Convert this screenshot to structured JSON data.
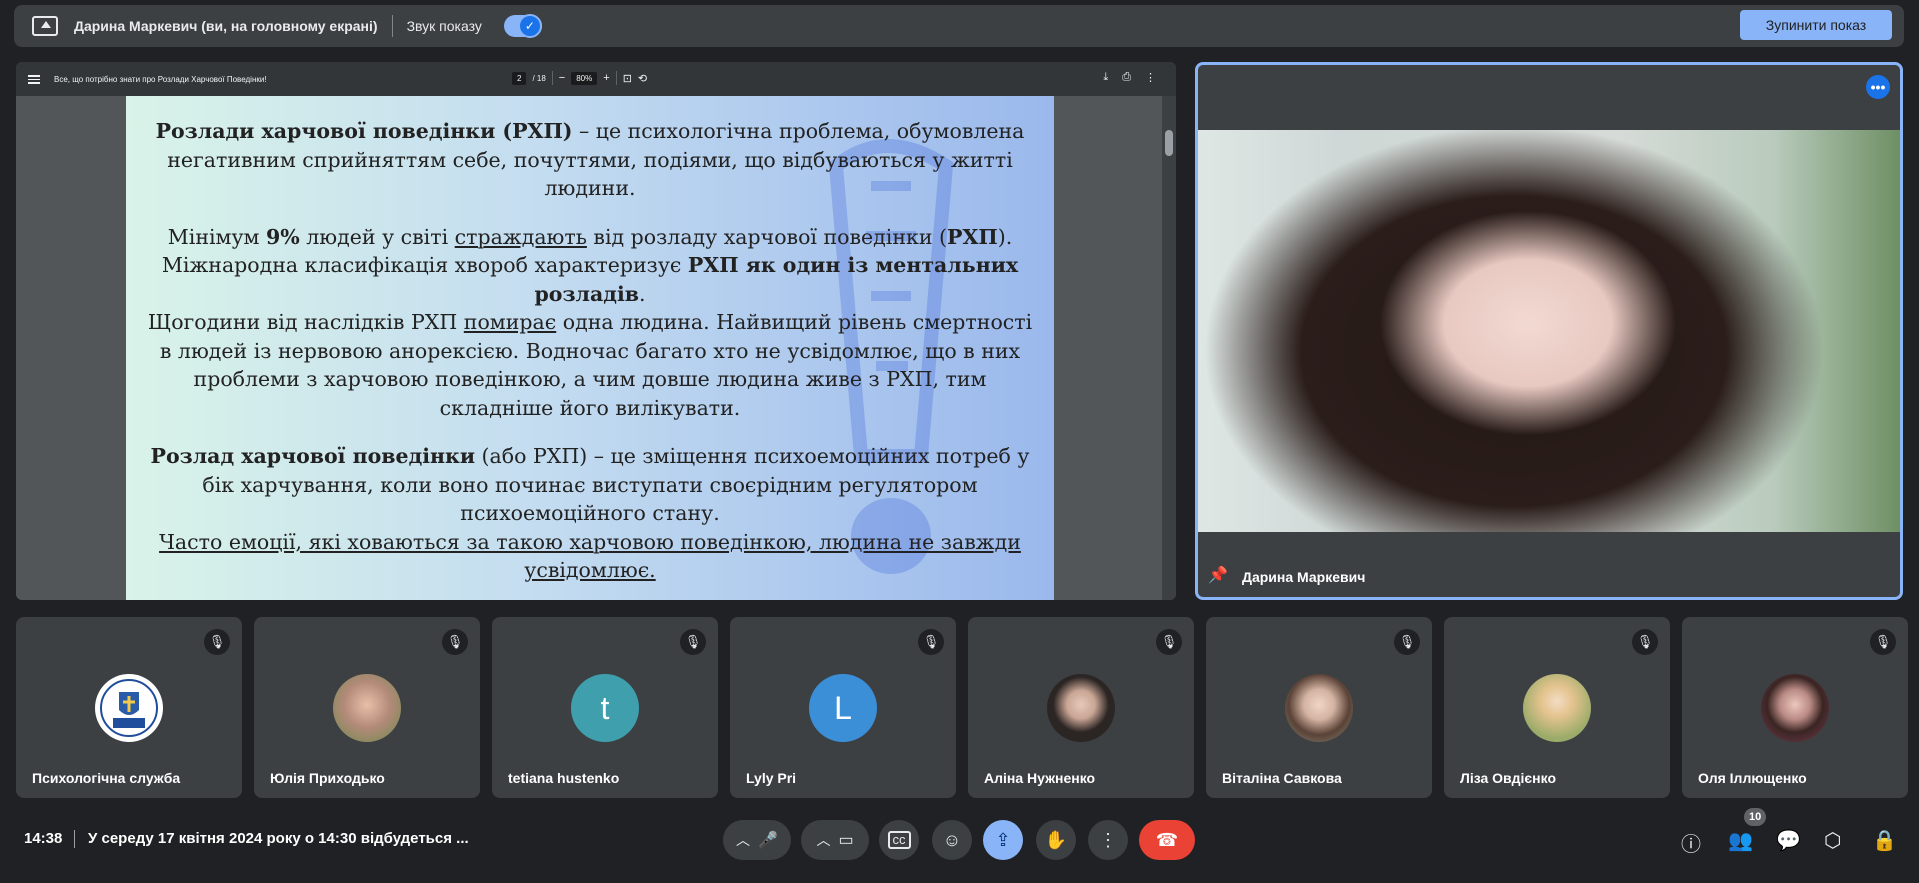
{
  "topbar": {
    "presenter_text": "Дарина Маркевич (ви, на головному екрані)",
    "sound_label": "Звук показу",
    "sound_on": true,
    "stop_button": "Зупинити показ"
  },
  "pdf": {
    "title": "Все, що потрібно знати про Розлади Харчової Поведінки!",
    "page_current": "2",
    "page_total": "/ 18",
    "zoom": "80%"
  },
  "slide": {
    "p1_b": "Розлади харчової поведінки (РХП)",
    "p1_rest": " – це психологічна проблема, обумовлена негативним сприйняттям себе, почуттями, подіями, що відбуваються у житті людини.",
    "p2_a": "Мінімум ",
    "p2_b1": "9%",
    "p2_c": " людей у світі ",
    "p2_u1": "страждають",
    "p2_d": " від розладу харчової поведінки (",
    "p2_b2": "РХП",
    "p2_e": "). Міжнародна класифікація хвороб характеризує ",
    "p2_b3": "РХП як один із ментальних розладів",
    "p2_f": ".",
    "p3_a": "Щогодини від наслідків РХП ",
    "p3_u": "помирає",
    "p3_b": " одна людина. Найвищий рівень смертності в людей із нервовою анорексією. Водночас багато хто не усвідомлює, що в них проблеми з харчовою поведінкою, а чим довше людина живе з РХП, тим складніше його вилікувати.",
    "p4_b": "Розлад харчової поведінки",
    "p4_rest": " (або РХП) – це зміщення психоемоційних потреб у бік харчування, коли воно починає виступати своєрідним регулятором психоемоційного стану.",
    "p5_u": "Часто емоції, які ховаються за такою харчовою поведінкою, людина не завжди усвідомлює."
  },
  "speaker": {
    "name": "Дарина Маркевич"
  },
  "participants": [
    {
      "name": "Психологічна служба",
      "initial": "",
      "avatar_color": "#ffffff",
      "kind": "logo"
    },
    {
      "name": "Юлія Приходько",
      "initial": "",
      "avatar_color": "#b48a7a",
      "kind": "photo"
    },
    {
      "name": "tetiana hustenko",
      "initial": "t",
      "avatar_color": "#3f9fad",
      "kind": "letter"
    },
    {
      "name": "Lyly Pri",
      "initial": "L",
      "avatar_color": "#3b8fd6",
      "kind": "letter"
    },
    {
      "name": "Аліна Нужненко",
      "initial": "",
      "avatar_color": "#2b2524",
      "kind": "photo"
    },
    {
      "name": "Віталіна Савкова",
      "initial": "",
      "avatar_color": "#8c8a7d",
      "kind": "photo"
    },
    {
      "name": "Ліза Овдієнко",
      "initial": "",
      "avatar_color": "#9bab6a",
      "kind": "photo"
    },
    {
      "name": "Оля Іллющенко",
      "initial": "",
      "avatar_color": "#7a3d52",
      "kind": "photo"
    }
  ],
  "bottombar": {
    "time": "14:38",
    "meeting_title": "У середу 17 квітня 2024 року о 14:30 відбудеться ...",
    "participant_count": "10"
  },
  "colors": {
    "accent": "#8ab4f8",
    "end_call": "#ea4335",
    "tile": "#3c4043",
    "background": "#202124"
  }
}
